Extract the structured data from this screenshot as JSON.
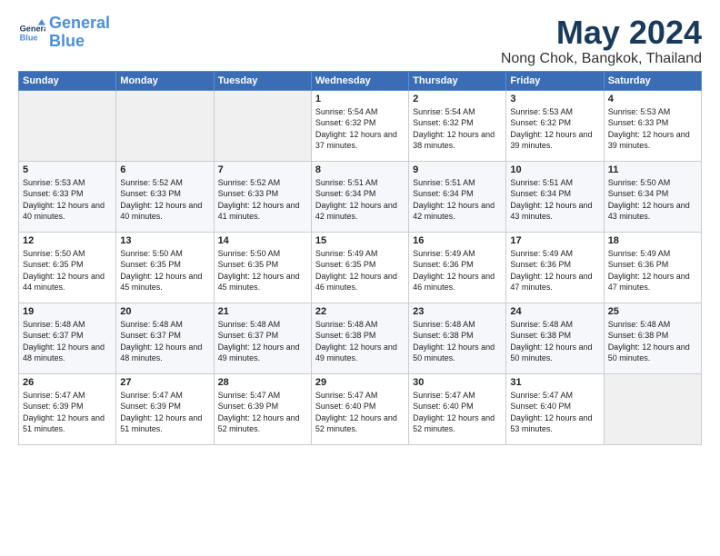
{
  "logo": {
    "line1": "General",
    "line2": "Blue"
  },
  "title": "May 2024",
  "location": "Nong Chok, Bangkok, Thailand",
  "days_of_week": [
    "Sunday",
    "Monday",
    "Tuesday",
    "Wednesday",
    "Thursday",
    "Friday",
    "Saturday"
  ],
  "weeks": [
    [
      {
        "num": "",
        "sunrise": "",
        "sunset": "",
        "daylight": "",
        "empty": true
      },
      {
        "num": "",
        "sunrise": "",
        "sunset": "",
        "daylight": "",
        "empty": true
      },
      {
        "num": "",
        "sunrise": "",
        "sunset": "",
        "daylight": "",
        "empty": true
      },
      {
        "num": "1",
        "sunrise": "5:54 AM",
        "sunset": "6:32 PM",
        "daylight": "12 hours and 37 minutes."
      },
      {
        "num": "2",
        "sunrise": "5:54 AM",
        "sunset": "6:32 PM",
        "daylight": "12 hours and 38 minutes."
      },
      {
        "num": "3",
        "sunrise": "5:53 AM",
        "sunset": "6:32 PM",
        "daylight": "12 hours and 39 minutes."
      },
      {
        "num": "4",
        "sunrise": "5:53 AM",
        "sunset": "6:33 PM",
        "daylight": "12 hours and 39 minutes."
      }
    ],
    [
      {
        "num": "5",
        "sunrise": "5:53 AM",
        "sunset": "6:33 PM",
        "daylight": "12 hours and 40 minutes."
      },
      {
        "num": "6",
        "sunrise": "5:52 AM",
        "sunset": "6:33 PM",
        "daylight": "12 hours and 40 minutes."
      },
      {
        "num": "7",
        "sunrise": "5:52 AM",
        "sunset": "6:33 PM",
        "daylight": "12 hours and 41 minutes."
      },
      {
        "num": "8",
        "sunrise": "5:51 AM",
        "sunset": "6:34 PM",
        "daylight": "12 hours and 42 minutes."
      },
      {
        "num": "9",
        "sunrise": "5:51 AM",
        "sunset": "6:34 PM",
        "daylight": "12 hours and 42 minutes."
      },
      {
        "num": "10",
        "sunrise": "5:51 AM",
        "sunset": "6:34 PM",
        "daylight": "12 hours and 43 minutes."
      },
      {
        "num": "11",
        "sunrise": "5:50 AM",
        "sunset": "6:34 PM",
        "daylight": "12 hours and 43 minutes."
      }
    ],
    [
      {
        "num": "12",
        "sunrise": "5:50 AM",
        "sunset": "6:35 PM",
        "daylight": "12 hours and 44 minutes."
      },
      {
        "num": "13",
        "sunrise": "5:50 AM",
        "sunset": "6:35 PM",
        "daylight": "12 hours and 45 minutes."
      },
      {
        "num": "14",
        "sunrise": "5:50 AM",
        "sunset": "6:35 PM",
        "daylight": "12 hours and 45 minutes."
      },
      {
        "num": "15",
        "sunrise": "5:49 AM",
        "sunset": "6:35 PM",
        "daylight": "12 hours and 46 minutes."
      },
      {
        "num": "16",
        "sunrise": "5:49 AM",
        "sunset": "6:36 PM",
        "daylight": "12 hours and 46 minutes."
      },
      {
        "num": "17",
        "sunrise": "5:49 AM",
        "sunset": "6:36 PM",
        "daylight": "12 hours and 47 minutes."
      },
      {
        "num": "18",
        "sunrise": "5:49 AM",
        "sunset": "6:36 PM",
        "daylight": "12 hours and 47 minutes."
      }
    ],
    [
      {
        "num": "19",
        "sunrise": "5:48 AM",
        "sunset": "6:37 PM",
        "daylight": "12 hours and 48 minutes."
      },
      {
        "num": "20",
        "sunrise": "5:48 AM",
        "sunset": "6:37 PM",
        "daylight": "12 hours and 48 minutes."
      },
      {
        "num": "21",
        "sunrise": "5:48 AM",
        "sunset": "6:37 PM",
        "daylight": "12 hours and 49 minutes."
      },
      {
        "num": "22",
        "sunrise": "5:48 AM",
        "sunset": "6:38 PM",
        "daylight": "12 hours and 49 minutes."
      },
      {
        "num": "23",
        "sunrise": "5:48 AM",
        "sunset": "6:38 PM",
        "daylight": "12 hours and 50 minutes."
      },
      {
        "num": "24",
        "sunrise": "5:48 AM",
        "sunset": "6:38 PM",
        "daylight": "12 hours and 50 minutes."
      },
      {
        "num": "25",
        "sunrise": "5:48 AM",
        "sunset": "6:38 PM",
        "daylight": "12 hours and 50 minutes."
      }
    ],
    [
      {
        "num": "26",
        "sunrise": "5:47 AM",
        "sunset": "6:39 PM",
        "daylight": "12 hours and 51 minutes."
      },
      {
        "num": "27",
        "sunrise": "5:47 AM",
        "sunset": "6:39 PM",
        "daylight": "12 hours and 51 minutes."
      },
      {
        "num": "28",
        "sunrise": "5:47 AM",
        "sunset": "6:39 PM",
        "daylight": "12 hours and 52 minutes."
      },
      {
        "num": "29",
        "sunrise": "5:47 AM",
        "sunset": "6:40 PM",
        "daylight": "12 hours and 52 minutes."
      },
      {
        "num": "30",
        "sunrise": "5:47 AM",
        "sunset": "6:40 PM",
        "daylight": "12 hours and 52 minutes."
      },
      {
        "num": "31",
        "sunrise": "5:47 AM",
        "sunset": "6:40 PM",
        "daylight": "12 hours and 53 minutes."
      },
      {
        "num": "",
        "sunrise": "",
        "sunset": "",
        "daylight": "",
        "empty": true
      }
    ]
  ],
  "labels": {
    "sunrise_prefix": "Sunrise:",
    "sunset_prefix": "Sunset:",
    "daylight_prefix": "Daylight:"
  }
}
